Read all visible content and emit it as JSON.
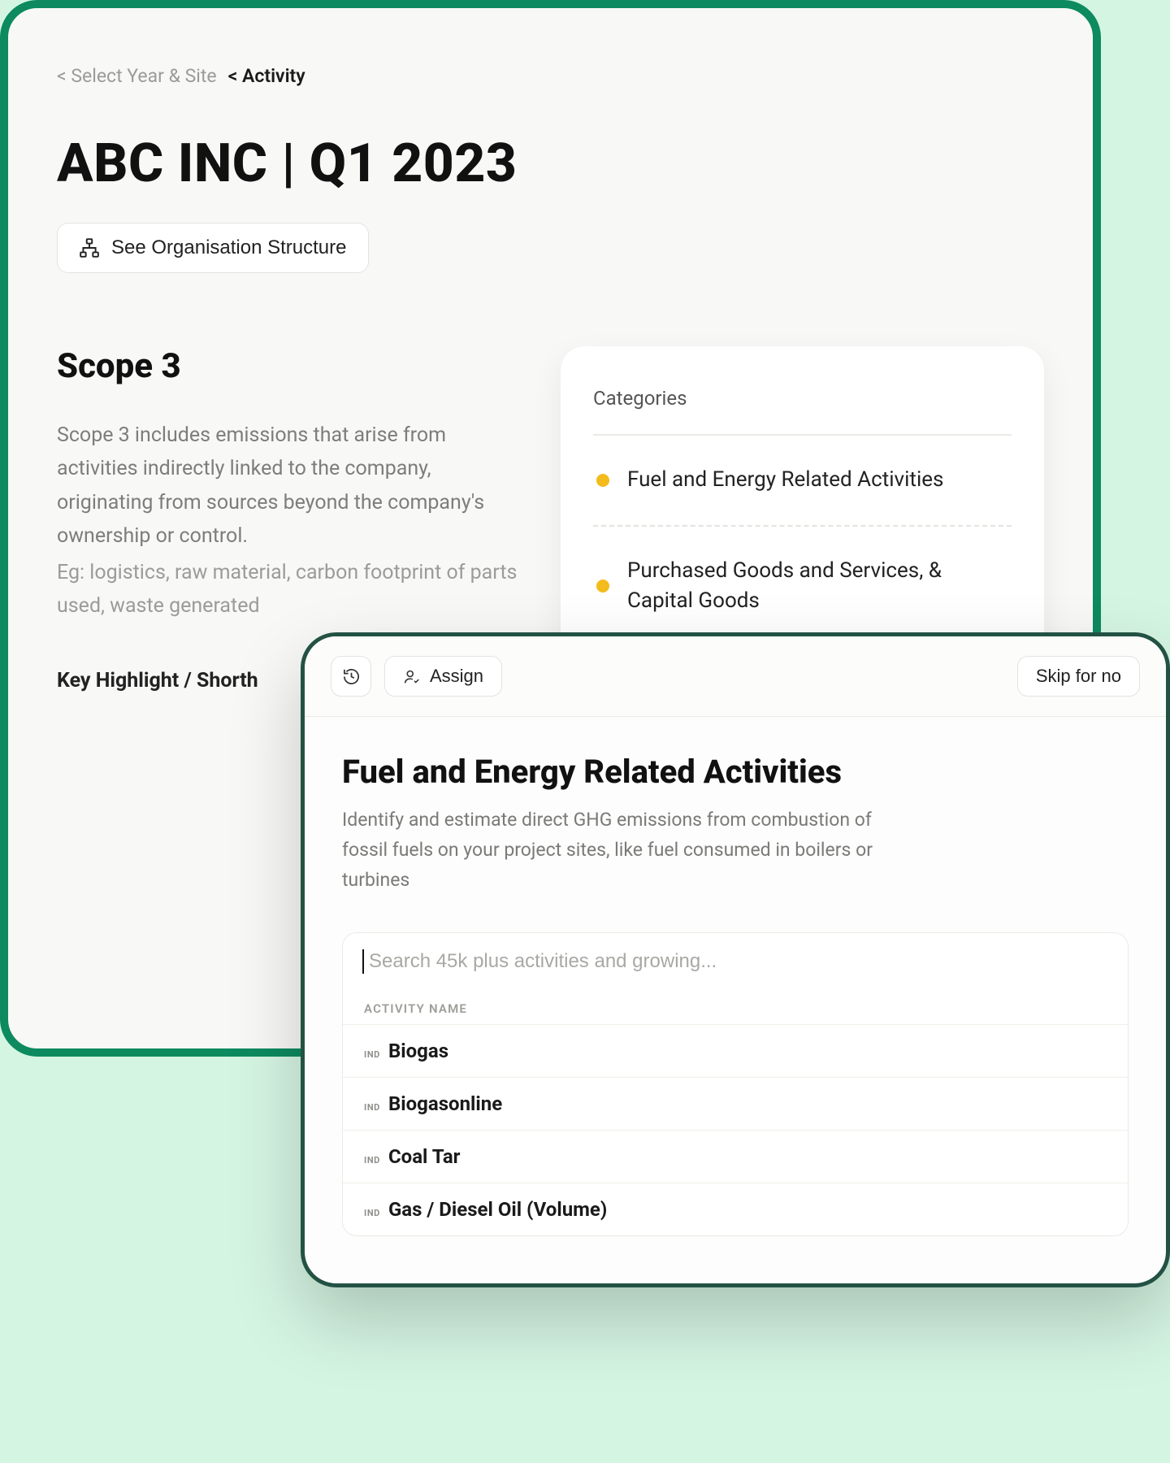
{
  "breadcrumb": {
    "prev": "< Select Year & Site",
    "current": "< Activity"
  },
  "page_title": "ABC INC | Q1 2023",
  "org_button": "See Organisation Structure",
  "scope": {
    "title": "Scope 3",
    "description": "Scope 3 includes emissions that arise from activities indirectly linked to the company, originating from sources beyond the company's ownership or control.",
    "example": "Eg: logistics, raw material, carbon footprint of parts used, waste generated",
    "key_highlight_label": "Key Highlight / Shorth"
  },
  "categories": {
    "heading": "Categories",
    "items": [
      {
        "label": "Fuel and Energy Related Activities",
        "status_color": "#f3bc1c"
      },
      {
        "label": "Purchased Goods and Services, & Capital Goods",
        "status_color": "#f3bc1c"
      }
    ]
  },
  "dialog": {
    "assign_label": "Assign",
    "skip_label": "Skip for no",
    "title": "Fuel and Energy Related Activities",
    "description": "Identify and estimate direct GHG emissions from combustion of fossil fuels on your project sites, like fuel consumed in boilers or turbines",
    "search_placeholder": "Search 45k plus activities and growing...",
    "column_header": "ACTIVITY NAME",
    "activities": [
      {
        "tag": "IND",
        "name": "Biogas"
      },
      {
        "tag": "IND",
        "name": "Biogasonline"
      },
      {
        "tag": "IND",
        "name": "Coal Tar"
      },
      {
        "tag": "IND",
        "name": "Gas / Diesel Oil (Volume)"
      }
    ]
  }
}
